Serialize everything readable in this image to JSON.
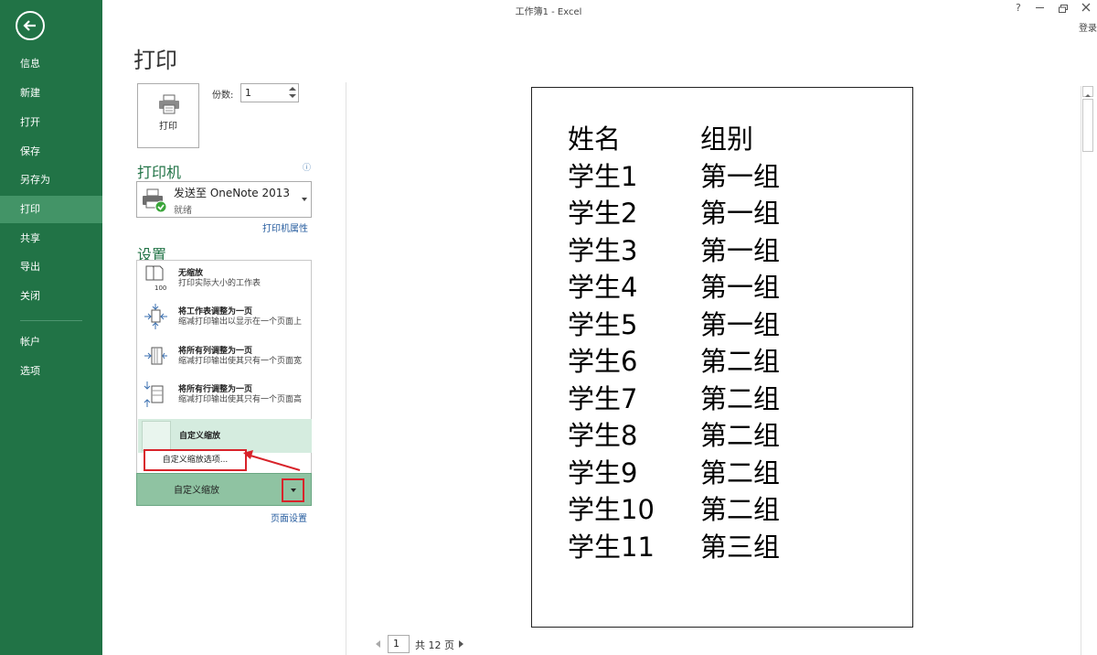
{
  "window": {
    "title": "工作簿1 - Excel",
    "help": "?",
    "login": "登录"
  },
  "nav": {
    "items": [
      {
        "label": "信息"
      },
      {
        "label": "新建"
      },
      {
        "label": "打开"
      },
      {
        "label": "保存"
      },
      {
        "label": "另存为"
      },
      {
        "label": "打印",
        "active": true
      },
      {
        "label": "共享"
      },
      {
        "label": "导出"
      },
      {
        "label": "关闭"
      },
      {
        "label": "帐户"
      },
      {
        "label": "选项"
      }
    ]
  },
  "print": {
    "heading": "打印",
    "print_button_label": "打印",
    "copies_label": "份数:",
    "copies_value": "1"
  },
  "printer": {
    "heading": "打印机",
    "name": "发送至 OneNote 2013",
    "status": "就绪",
    "properties_link": "打印机属性"
  },
  "settings": {
    "heading": "设置",
    "scale_options": [
      {
        "title": "无缩放",
        "desc": "打印实际大小的工作表"
      },
      {
        "title": "将工作表调整为一页",
        "desc": "缩减打印输出以显示在一个页面上"
      },
      {
        "title": "将所有列调整为一页",
        "desc": "缩减打印输出使其只有一个页面宽"
      },
      {
        "title": "将所有行调整为一页",
        "desc": "缩减打印输出使其只有一个页面高"
      }
    ],
    "custom_scale_item": "自定义缩放",
    "custom_scale_options": "自定义缩放选项...",
    "selected_scale": "自定义缩放",
    "page_setup_link": "页面设置"
  },
  "preview": {
    "rows": [
      [
        "姓名",
        "组别"
      ],
      [
        "学生1",
        "第一组"
      ],
      [
        "学生2",
        "第一组"
      ],
      [
        "学生3",
        "第一组"
      ],
      [
        "学生4",
        "第一组"
      ],
      [
        "学生5",
        "第一组"
      ],
      [
        "学生6",
        "第二组"
      ],
      [
        "学生7",
        "第二组"
      ],
      [
        "学生8",
        "第二组"
      ],
      [
        "学生9",
        "第二组"
      ],
      [
        "学生10",
        "第二组"
      ],
      [
        "学生11",
        "第三组"
      ]
    ],
    "current_page": "1",
    "total_pages_text": "共 12 页"
  },
  "colors": {
    "accent_green": "#217346",
    "annotation_red": "#d8232a"
  }
}
